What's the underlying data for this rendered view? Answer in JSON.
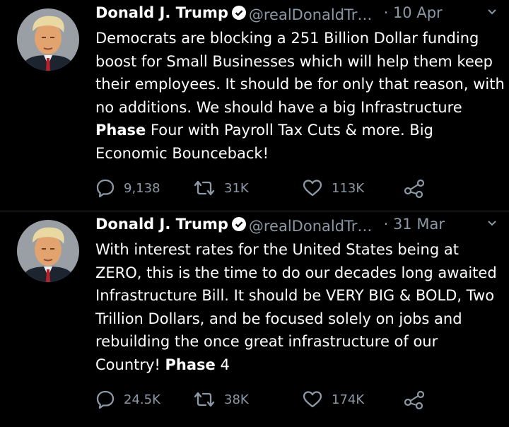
{
  "tweets": [
    {
      "name": "Donald J. Trump",
      "handle": "@realDonaldTrump",
      "separator": "·",
      "date": "10 Apr",
      "text_before": "Democrats are blocking a 251 Billion Dollar funding boost for Small Businesses which will help them keep their employees. It should be for only that reason, with no additions. We should have a big Infrastructure ",
      "highlight": "Phase",
      "text_after": " Four with Payroll Tax Cuts & more. Big Economic Bounceback!",
      "replies": "9,138",
      "retweets": "31K",
      "likes": "113K"
    },
    {
      "name": "Donald J. Trump",
      "handle": "@realDonaldTrump",
      "separator": "·",
      "date": "31 Mar",
      "text_before": "With interest rates for the United States being at ZERO, this is the time to do our decades long awaited Infrastructure Bill. It should be VERY BIG & BOLD, Two Trillion Dollars, and be focused solely on jobs and rebuilding the once great infrastructure of our Country! ",
      "highlight": "Phase",
      "text_after": " 4",
      "replies": "24.5K",
      "retweets": "38K",
      "likes": "174K"
    }
  ],
  "icons": {
    "verified": "verified-badge-icon",
    "caret": "chevron-down-icon",
    "reply": "reply-icon",
    "retweet": "retweet-icon",
    "like": "heart-icon",
    "share": "share-icon"
  },
  "colors": {
    "background": "#000000",
    "text": "#ffffff",
    "muted": "#8b98a5",
    "divider": "#2f3336"
  }
}
